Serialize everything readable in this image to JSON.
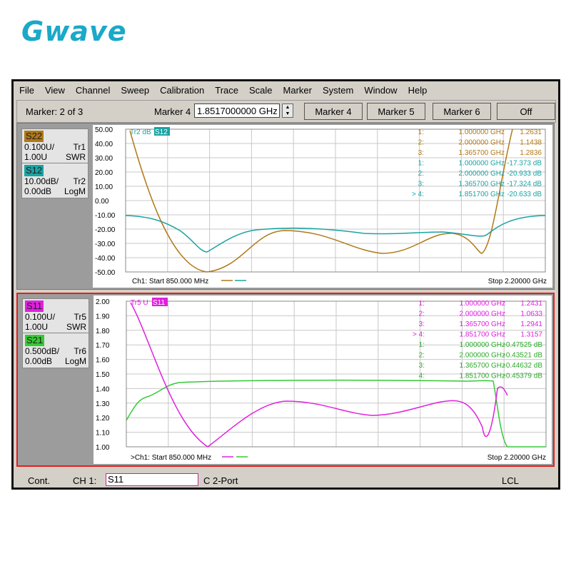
{
  "logo": "Gwave",
  "menu": [
    "File",
    "View",
    "Channel",
    "Sweep",
    "Calibration",
    "Trace",
    "Scale",
    "Marker",
    "System",
    "Window",
    "Help"
  ],
  "toolbar": {
    "marker_count": "Marker: 2 of 3",
    "marker_label": "Marker 4",
    "marker_value": "1.8517000000 GHz",
    "buttons": [
      {
        "label": "Marker 4",
        "color": "#ffff00"
      },
      {
        "label": "Marker 5",
        "color": "#5ccf5c"
      },
      {
        "label": "Marker 6",
        "color": "#a9a9ff"
      },
      {
        "label": "Off",
        "color": "#ff6fa4"
      }
    ]
  },
  "status": {
    "mode": "Cont.",
    "channel": "CH 1:",
    "param": "S11",
    "port": "C  2-Port",
    "lcl": "LCL"
  },
  "panel1": {
    "traces": [
      {
        "name": "S22",
        "color": "#b07818",
        "scale": "0.100U/",
        "tr": "Tr1",
        "ref": "1.00U",
        "fmt": "SWR"
      },
      {
        "name": "S12",
        "color": "#1aa3a3",
        "scale": "10.00dB/",
        "tr": "Tr2",
        "ref": "0.00dB",
        "fmt": "LogM"
      }
    ],
    "y_ticks": [
      "50.00",
      "40.00",
      "30.00",
      "20.00",
      "10.00",
      "0.00",
      "-10.00",
      "-20.00",
      "-30.00",
      "-40.00",
      "-50.00"
    ],
    "trace_label_prefix": "Tr2 dB",
    "trace_label_tag": "S12",
    "start": "Ch1: Start  850.000 MHz",
    "stop": "Stop  2.20000 GHz",
    "markers": [
      {
        "n": "1:",
        "f": "1.000000 GHz",
        "v": "1.2631",
        "color": "#b07818"
      },
      {
        "n": "2:",
        "f": "2.000000 GHz",
        "v": "1.1438",
        "color": "#b07818"
      },
      {
        "n": "3:",
        "f": "1.365700 GHz",
        "v": "1.2836",
        "color": "#b07818"
      },
      {
        "n": "1:",
        "f": "1.000000 GHz",
        "v": "-17.373 dB",
        "color": "#1aa3a3"
      },
      {
        "n": "2:",
        "f": "2.000000 GHz",
        "v": "-20.933 dB",
        "color": "#1aa3a3"
      },
      {
        "n": "3:",
        "f": "1.365700 GHz",
        "v": "-17.324 dB",
        "color": "#1aa3a3"
      },
      {
        "n": "> 4:",
        "f": "1.851700 GHz",
        "v": "-20.633 dB",
        "color": "#1aa3a3"
      }
    ]
  },
  "panel2": {
    "traces": [
      {
        "name": "S11",
        "color": "#e020e0",
        "scale": "0.100U/",
        "tr": "Tr5",
        "ref": "1.00U",
        "fmt": "SWR"
      },
      {
        "name": "S21",
        "color": "#36c936",
        "scale": "0.500dB/",
        "tr": "Tr6",
        "ref": "0.00dB",
        "fmt": "LogM"
      }
    ],
    "y_ticks": [
      "2.00",
      "1.90",
      "1.80",
      "1.70",
      "1.60",
      "1.50",
      "1.40",
      "1.30",
      "1.20",
      "1.10",
      "1.00"
    ],
    "trace_label_prefix": "Tr5 U",
    "trace_label_tag": "S11",
    "start": ">Ch1: Start  850.000 MHz",
    "stop": "Stop  2.20000 GHz",
    "markers": [
      {
        "n": "1:",
        "f": "1.000000 GHz",
        "v": "1.2431",
        "color": "#e020e0"
      },
      {
        "n": "2:",
        "f": "2.000000 GHz",
        "v": "1.0633",
        "color": "#e020e0"
      },
      {
        "n": "3:",
        "f": "1.365700 GHz",
        "v": "1.2941",
        "color": "#e020e0"
      },
      {
        "n": "> 4:",
        "f": "1.851700 GHz",
        "v": "1.3157",
        "color": "#e020e0"
      },
      {
        "n": "1:",
        "f": "1.000000 GHz",
        "v": "-0.47525 dB",
        "color": "#2ea82e"
      },
      {
        "n": "2:",
        "f": "2.000000 GHz",
        "v": "-0.43521 dB",
        "color": "#2ea82e"
      },
      {
        "n": "3:",
        "f": "1.365700 GHz",
        "v": "-0.44632 dB",
        "color": "#2ea82e"
      },
      {
        "n": "4:",
        "f": "1.851700 GHz",
        "v": "-0.45379 dB",
        "color": "#2ea82e"
      }
    ]
  }
}
